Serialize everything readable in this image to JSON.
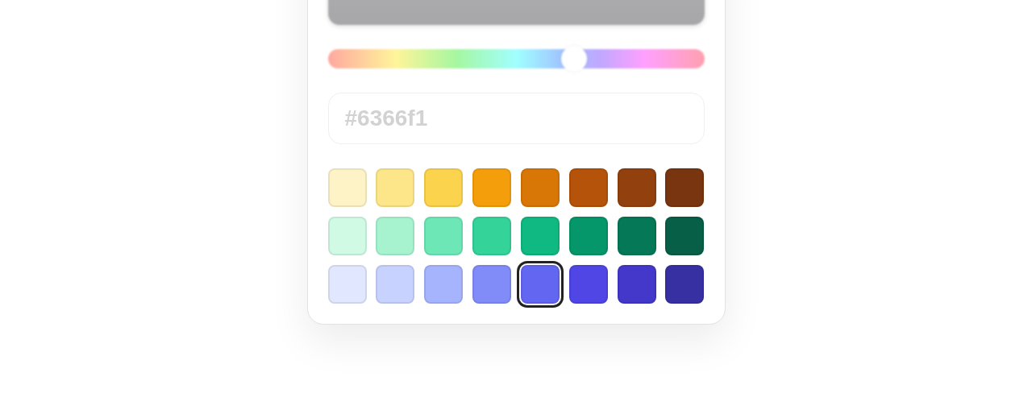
{
  "hue_slider": {
    "level": 0.655
  },
  "hex_field": {
    "placeholder": "#6366f1"
  },
  "swatch_rows": [
    [
      {
        "color": "#fef3c7",
        "selected": false
      },
      {
        "color": "#fde68a",
        "selected": false
      },
      {
        "color": "#fcd34d",
        "selected": false
      },
      {
        "color": "#f59e0b",
        "selected": false
      },
      {
        "color": "#d97706",
        "selected": false
      },
      {
        "color": "#b45309",
        "selected": false
      },
      {
        "color": "#92400e",
        "selected": false
      },
      {
        "color": "#78350f",
        "selected": false
      }
    ],
    [
      {
        "color": "#d1fae5",
        "selected": false
      },
      {
        "color": "#a7f3d0",
        "selected": false
      },
      {
        "color": "#6ee7b7",
        "selected": false
      },
      {
        "color": "#34d399",
        "selected": false
      },
      {
        "color": "#10b981",
        "selected": false
      },
      {
        "color": "#059669",
        "selected": false
      },
      {
        "color": "#047857",
        "selected": false
      },
      {
        "color": "#065f46",
        "selected": false
      }
    ],
    [
      {
        "color": "#e0e7ff",
        "selected": false
      },
      {
        "color": "#c7d2fe",
        "selected": false
      },
      {
        "color": "#a5b4fc",
        "selected": false
      },
      {
        "color": "#818cf8",
        "selected": false
      },
      {
        "color": "#6366f1",
        "selected": true
      },
      {
        "color": "#4f46e5",
        "selected": false
      },
      {
        "color": "#4338ca",
        "selected": false
      },
      {
        "color": "#3730a3",
        "selected": false
      }
    ]
  ]
}
